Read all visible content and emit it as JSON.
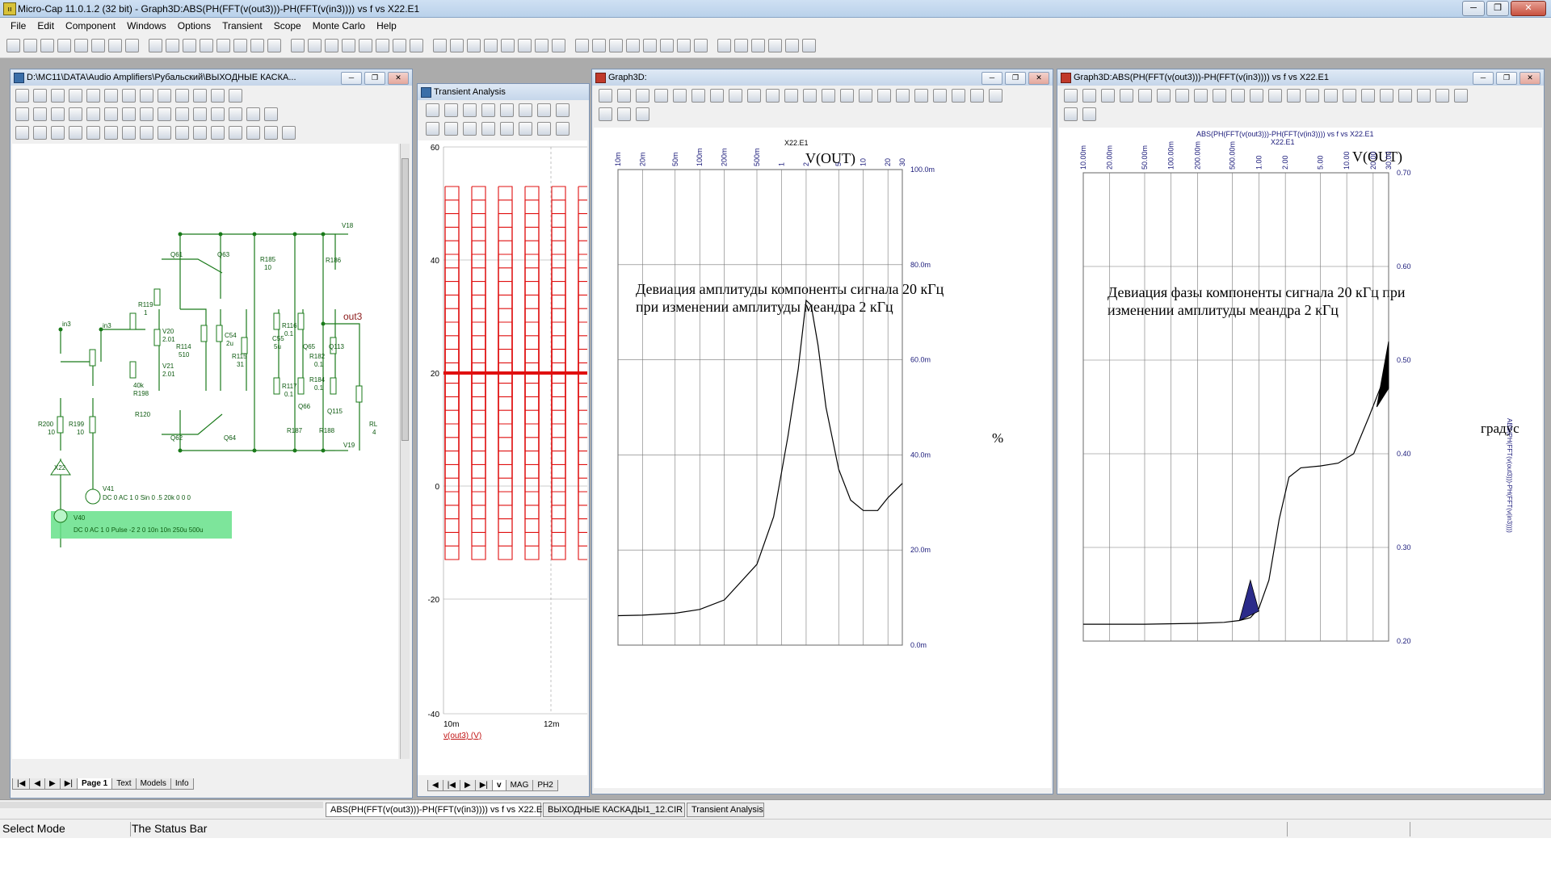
{
  "app": {
    "title": "Micro-Cap 11.0.1.2 (32 bit) - Graph3D:ABS(PH(FFT(v(out3)))-PH(FFT(v(in3)))) vs f vs X22.E1",
    "icon": "app-icon",
    "window_buttons": [
      "─",
      "❐",
      "✕"
    ]
  },
  "menu": [
    "File",
    "Edit",
    "Component",
    "Windows",
    "Options",
    "Transient",
    "Scope",
    "Monte Carlo",
    "Help"
  ],
  "schematic_window": {
    "title": "D:\\MC11\\DATA\\Audio Amplifiers\\Рубальский\\ВЫХОДНЫЕ КАСКА...",
    "tabs": [
      "Page 1",
      "Text",
      "Models",
      "Info"
    ],
    "active_tab": "Page 1",
    "labels": {
      "v18": "V18",
      "v19": "V19",
      "q61": "Q61",
      "q63": "Q63",
      "q62": "Q62",
      "q64": "Q64",
      "q65": "Q65",
      "q113": "Q113",
      "q66": "Q66",
      "q115": "Q115",
      "r185": "R185",
      "r185v": "10",
      "r186": "R186",
      "r119": "R119",
      "r119v": "1",
      "v20": "V20",
      "v20v": "2.01",
      "v21": "V21",
      "v21v": "2.01",
      "r114": "R114",
      "r114v": "510",
      "c54": "C54",
      "c54v": "2u",
      "r115": "R115",
      "r115v": "31",
      "c55": "C55",
      "c55v": "5u",
      "r116": "R116",
      "r116v": "0.1",
      "r182": "R182",
      "r182v": "0.1",
      "r117": "R117",
      "r117v": "0.1",
      "r184": "R184",
      "r184v": "0.1",
      "r187": "R187",
      "r188": "R188",
      "out3": "out3",
      "in3": "in3",
      "in3b": "in3",
      "r40k": "40k",
      "r198": "R198",
      "r120": "R120",
      "r200": "R200",
      "r200v": "10",
      "r199": "R199",
      "r199v": "10",
      "rl": "RL",
      "rlv": "4",
      "x22": "X22",
      "v41": "V41",
      "v41src": "DC 0 AC 1 0 Sin 0 .5 20k 0 0 0",
      "v40": "V40",
      "v40src": "DC 0 AC 1 0 Pulse -2 2 0 10n 10n 250u 500u"
    }
  },
  "transient_window": {
    "title": "Transient Analysis",
    "y_ticks": [
      "60",
      "40",
      "20",
      "0",
      "-20",
      "-40"
    ],
    "x_ticks": [
      "10m",
      "12m"
    ],
    "trace_label": "v(out3) (V)",
    "tabs": [
      "v",
      "MAG",
      "PH2"
    ],
    "trace_color": "#e01010"
  },
  "graph3d_window": {
    "title": "Graph3D:",
    "top_label": "X22.E1",
    "annotation_line1": "Девиация амплитуды компоненты сигнала 20 кГц",
    "annotation_line2": "при изменении амплитуды меандра 2 кГц",
    "unit_label": "%"
  },
  "graph3d_phase_window": {
    "title": "Graph3D:ABS(PH(FFT(v(out3)))-PH(FFT(v(in3)))) vs f vs X22.E1",
    "header_expr": "ABS(PH(FFT(v(out3)))-PH(FFT(v(in3)))) vs f vs X22.E1",
    "top_label": "X22.E1",
    "annotation_line1": "Девиация фазы компоненты сигнала 20 кГц при",
    "annotation_line2": "изменении амплитуды меандра 2 кГц",
    "unit_label": "градус",
    "side_axis_label": "ABS(PH(FFT(v(out3)))-PH(FFT(v(in3))))"
  },
  "chart_data": [
    {
      "type": "line",
      "title": "V(OUT)",
      "xlabel": "X22.E1",
      "ylabel": "%",
      "x_tick_labels": [
        "10m",
        "20m",
        "50m",
        "100m",
        "200m",
        "500m",
        "1",
        "2",
        "5",
        "10",
        "20",
        "30"
      ],
      "x_scale": "log",
      "ylim": [
        0,
        0.1
      ],
      "y_tick_labels": [
        "100.0m",
        "80.0m",
        "60.0m",
        "40.0m",
        "20.0m",
        "0.0m"
      ],
      "grid": true,
      "series": [
        {
          "x": [
            0.01,
            0.02,
            0.05,
            0.1,
            0.2,
            0.5,
            0.8,
            1.2,
            1.6,
            2.0,
            2.3,
            2.8,
            3.5,
            5,
            7,
            10,
            15,
            20,
            30
          ],
          "values": [
            0.0062,
            0.0063,
            0.0067,
            0.0075,
            0.0095,
            0.017,
            0.027,
            0.044,
            0.058,
            0.0725,
            0.0715,
            0.063,
            0.05,
            0.037,
            0.0305,
            0.0283,
            0.0283,
            0.031,
            0.034
          ]
        }
      ]
    },
    {
      "type": "line",
      "title": "V(OUT)",
      "xlabel": "X22.E1",
      "ylabel": "градус",
      "x_tick_labels": [
        "10.00m",
        "20.00m",
        "50.00m",
        "100.00m",
        "200.00m",
        "500.00m",
        "1.00",
        "2.00",
        "5.00",
        "10.00",
        "20.00",
        "30.00"
      ],
      "x_scale": "log",
      "ylim": [
        0.2,
        0.7
      ],
      "y_tick_labels": [
        "0.70",
        "0.60",
        "0.50",
        "0.40",
        "0.30",
        "0.20"
      ],
      "grid": true,
      "series": [
        {
          "x": [
            0.01,
            0.05,
            0.2,
            0.4,
            0.6,
            0.8,
            1.0,
            1.3,
            1.7,
            2.2,
            3.0,
            5.0,
            8.0,
            12,
            18,
            24,
            30
          ],
          "values": [
            0.218,
            0.218,
            0.219,
            0.22,
            0.222,
            0.225,
            0.235,
            0.265,
            0.33,
            0.375,
            0.385,
            0.387,
            0.39,
            0.4,
            0.44,
            0.47,
            0.49
          ]
        }
      ]
    }
  ],
  "doc_tabs": [
    "ABS(PH(FFT(v(out3)))-PH(FFT(v(in3)))) vs f vs X22.E1",
    "ВЫХОДНЫЕ КАСКАДЫ1_12.CIR",
    "Transient Analysis"
  ],
  "status": {
    "mode": "Select Mode",
    "text": "The Status Bar"
  }
}
